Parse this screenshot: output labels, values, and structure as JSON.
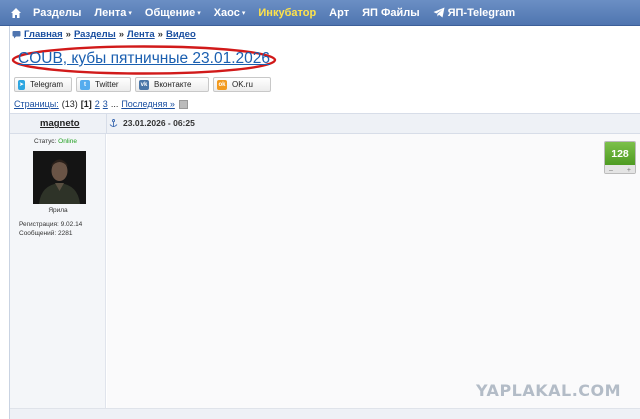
{
  "topnav": {
    "items": [
      {
        "label": "Разделы",
        "caret": false
      },
      {
        "label": "Лента",
        "caret": true
      },
      {
        "label": "Общение",
        "caret": true
      },
      {
        "label": "Хаос",
        "caret": true
      },
      {
        "label": "Инкубатор",
        "caret": false
      },
      {
        "label": "Арт",
        "caret": false
      },
      {
        "label": "ЯП Файлы",
        "caret": false
      },
      {
        "label": "ЯП-Telegram",
        "caret": false
      }
    ],
    "caret_glyph": "▾"
  },
  "breadcrumb": {
    "items": [
      "Главная",
      "Разделы",
      "Лента",
      "Видео"
    ],
    "separator": "»"
  },
  "title": "COUB, кубы пятничные 23.01.2026",
  "share": {
    "telegram": "Telegram",
    "twitter": "Twitter",
    "vk": "Вконтакте",
    "ok": "OK.ru"
  },
  "pager": {
    "label": "Страницы:",
    "count": "(13)",
    "current": "[1]",
    "page2": "2",
    "page3": "3",
    "ellipsis": "...",
    "last": "Последняя »"
  },
  "post": {
    "author": "magneto",
    "date": "23.01.2026 - 06:25",
    "status_label": "Статус:",
    "status_value": "Online",
    "avatar_caption": "Ярила",
    "registration": "Регистрация: 9.02.14",
    "messages": "Сообщений: 2281"
  },
  "rating": {
    "value": "128",
    "minus": "–",
    "plus": "+"
  },
  "watermark": "YAPLAKAL.COM",
  "colors": {
    "nav_bg": "#5a7fb8",
    "nav_highlight": "#ffe34a",
    "link": "#1a4fa0",
    "title_ellipse": "#d11a1a",
    "rating_green": "#5aa82a",
    "online_green": "#22a022"
  }
}
